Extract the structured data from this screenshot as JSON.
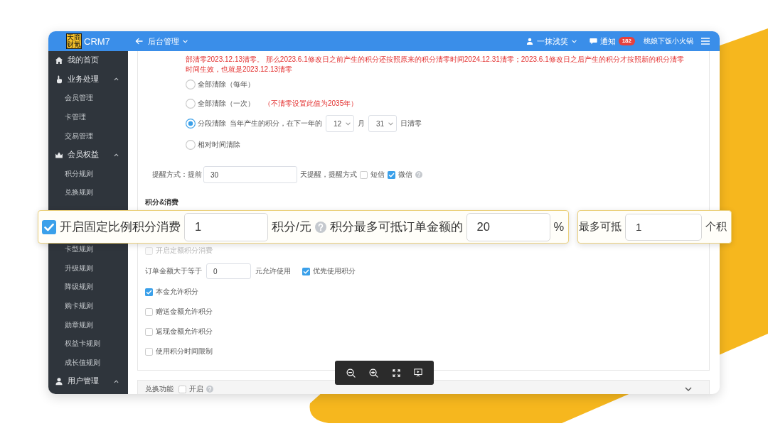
{
  "topbar": {
    "logo": "天商财氪",
    "app_name": "CRM7",
    "module_menu": "后台管理",
    "user": "一抹浅笑",
    "notifications": {
      "label": "通知",
      "count": "182"
    },
    "store": "桃娘下饭小火锅"
  },
  "sidebar": {
    "items": [
      {
        "kind": "link",
        "label": "我的首页"
      },
      {
        "kind": "group",
        "label": "业务处理",
        "expanded": true,
        "children": [
          {
            "label": "会员管理"
          },
          {
            "label": "卡管理"
          },
          {
            "label": "交易管理"
          }
        ]
      },
      {
        "kind": "group",
        "label": "会员权益",
        "expanded": true,
        "children": [
          {
            "label": "积分规则"
          },
          {
            "label": "兑换规则"
          },
          {
            "label": "卡型规则"
          },
          {
            "label": "升级规则"
          },
          {
            "label": "降级规则"
          },
          {
            "label": "购卡规则"
          },
          {
            "label": "勋章规则"
          },
          {
            "label": "权益卡规则"
          },
          {
            "label": "成长值规则"
          }
        ]
      },
      {
        "kind": "group",
        "label": "用户管理",
        "expanded": true
      }
    ]
  },
  "expiry": {
    "note_lines": [
      "部清零2023.12.13清零。 那么2023.6.1修改日之前产生的积分还按照原来的积分清零时间2024.12.31清零；2023.6.1修改日之后产生的积分才按照新的积分清零",
      "时间生效，也就是2023.12.13清零"
    ],
    "modes": [
      {
        "label": "全部清除（每年）",
        "selected": false
      },
      {
        "label": "全部清除（一次）",
        "note": "（不清零设置此值为2035年）",
        "selected": false
      },
      {
        "label": "分段清除",
        "schedule": {
          "text": "当年产生的积分，在下一年的",
          "month": "12",
          "month_unit": "月",
          "day": "31",
          "day_unit": "日清零"
        },
        "selected": true
      },
      {
        "label": "相对时间清除",
        "selected": false
      }
    ]
  },
  "reminder": {
    "label": "提醒方式：提前",
    "days": "30",
    "suffix": "天提醒，提醒方式",
    "channels": [
      {
        "label": "短信",
        "checked": false
      },
      {
        "label": "微信",
        "checked": true
      }
    ]
  },
  "points": {
    "title": "积分&消费",
    "rows": [
      {
        "kind": "checkbox",
        "label": "开启定额积分消费",
        "checked": false,
        "disabled": true
      },
      {
        "kind": "threshold",
        "label": "订单金额大于等于",
        "value": "0",
        "suffix": "元允许使用",
        "option": {
          "label": "优先使用积分",
          "checked": true
        },
        "disabled": false
      },
      {
        "kind": "checkbox",
        "label": "本金允许积分",
        "checked": true,
        "disabled": false
      },
      {
        "kind": "checkbox",
        "label": "赠送金额允许积分",
        "checked": false,
        "disabled": false
      },
      {
        "kind": "checkbox",
        "label": "返现金额允许积分",
        "checked": false,
        "disabled": false
      },
      {
        "kind": "checkbox",
        "label": "使用积分时间限制",
        "checked": false,
        "disabled": false
      }
    ]
  },
  "exchange": {
    "title": "兑换功能",
    "enabled_label": "开启",
    "enabled": false,
    "expanded": false
  },
  "callouts": [
    {
      "items": [
        {
          "kind": "checkbox",
          "label": "开启固定比例积分消费",
          "checked": true
        },
        {
          "kind": "input",
          "value": "1"
        },
        {
          "kind": "text",
          "text": "积分/元"
        },
        {
          "kind": "help"
        },
        {
          "kind": "text",
          "text": "积分最多可抵订单金额的"
        },
        {
          "kind": "input",
          "value": "20"
        },
        {
          "kind": "text",
          "text": "%"
        }
      ]
    },
    {
      "items": [
        {
          "kind": "text",
          "text": "最多可抵"
        },
        {
          "kind": "input",
          "value": "1"
        },
        {
          "kind": "text",
          "text": "个积"
        }
      ]
    }
  ]
}
